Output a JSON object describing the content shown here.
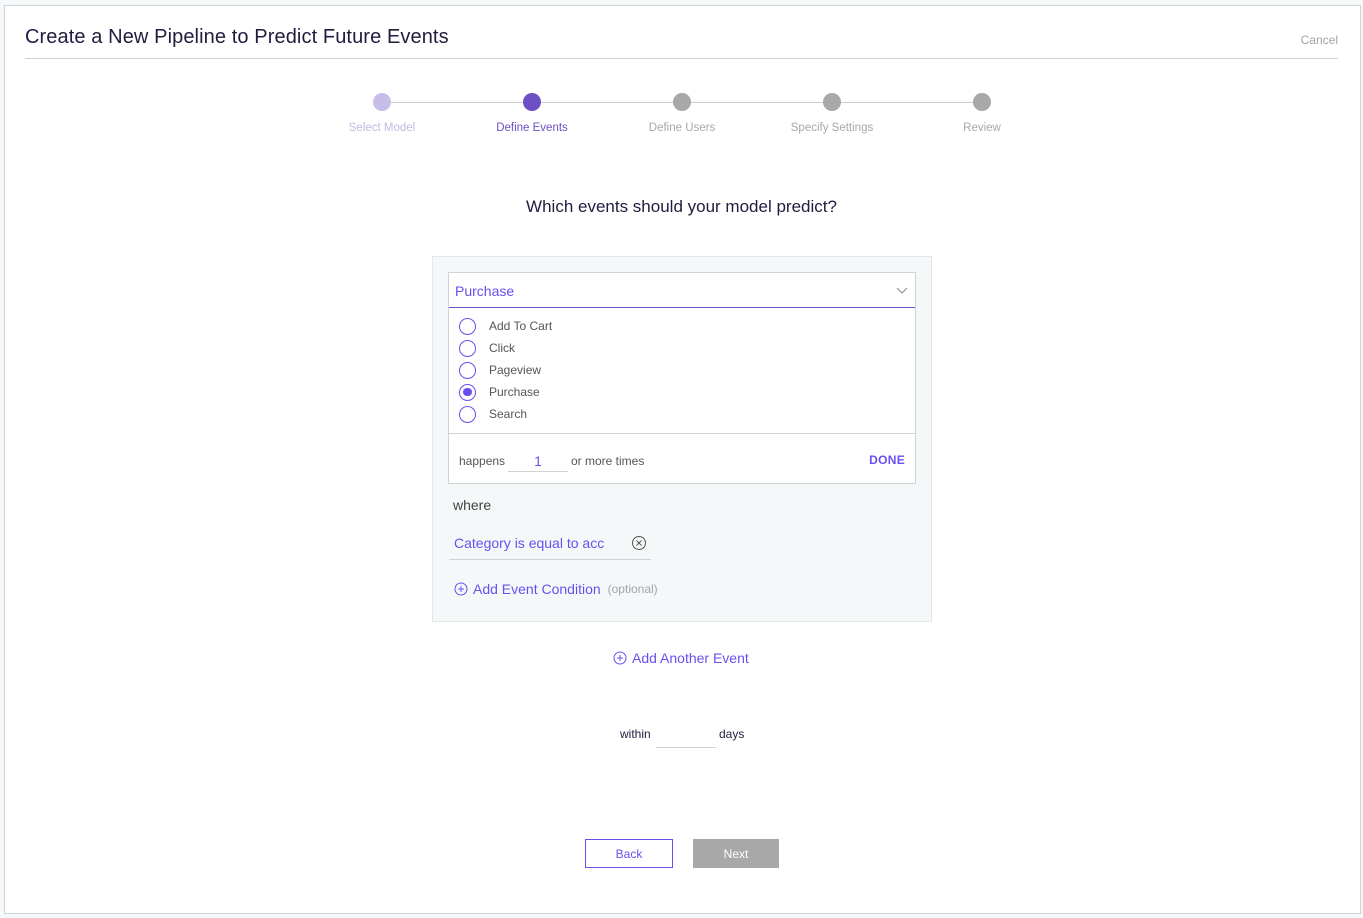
{
  "header": {
    "title": "Create a New Pipeline to Predict Future Events",
    "cancel_label": "Cancel"
  },
  "stepper": {
    "steps": [
      {
        "label": "Select Model",
        "state": "done"
      },
      {
        "label": "Define Events",
        "state": "active"
      },
      {
        "label": "Define Users",
        "state": "pending"
      },
      {
        "label": "Specify Settings",
        "state": "pending"
      },
      {
        "label": "Review",
        "state": "pending"
      }
    ]
  },
  "main": {
    "question": "Which events should your model predict?",
    "event": {
      "selected": "Purchase",
      "options": [
        {
          "label": "Add To Cart",
          "checked": false
        },
        {
          "label": "Click",
          "checked": false
        },
        {
          "label": "Pageview",
          "checked": false
        },
        {
          "label": "Purchase",
          "checked": true
        },
        {
          "label": "Search",
          "checked": false
        }
      ],
      "happens_label": "happens",
      "count_value": "1",
      "more_times_label": "or more times",
      "done_label": "DONE",
      "where_label": "where",
      "condition_text": "Category is equal to acc",
      "add_condition_label": "Add Event Condition",
      "optional_label": "(optional)"
    },
    "add_another_label": "Add Another Event",
    "within_label": "within",
    "days_value": "",
    "days_label": "days"
  },
  "footer": {
    "back_label": "Back",
    "next_label": "Next"
  },
  "colors": {
    "accent": "#6a4ff0",
    "step_active": "#6d4fc4",
    "step_done": "#c7bde8",
    "step_pending": "#a8a8a8",
    "disabled_button": "#a8a8a8"
  }
}
